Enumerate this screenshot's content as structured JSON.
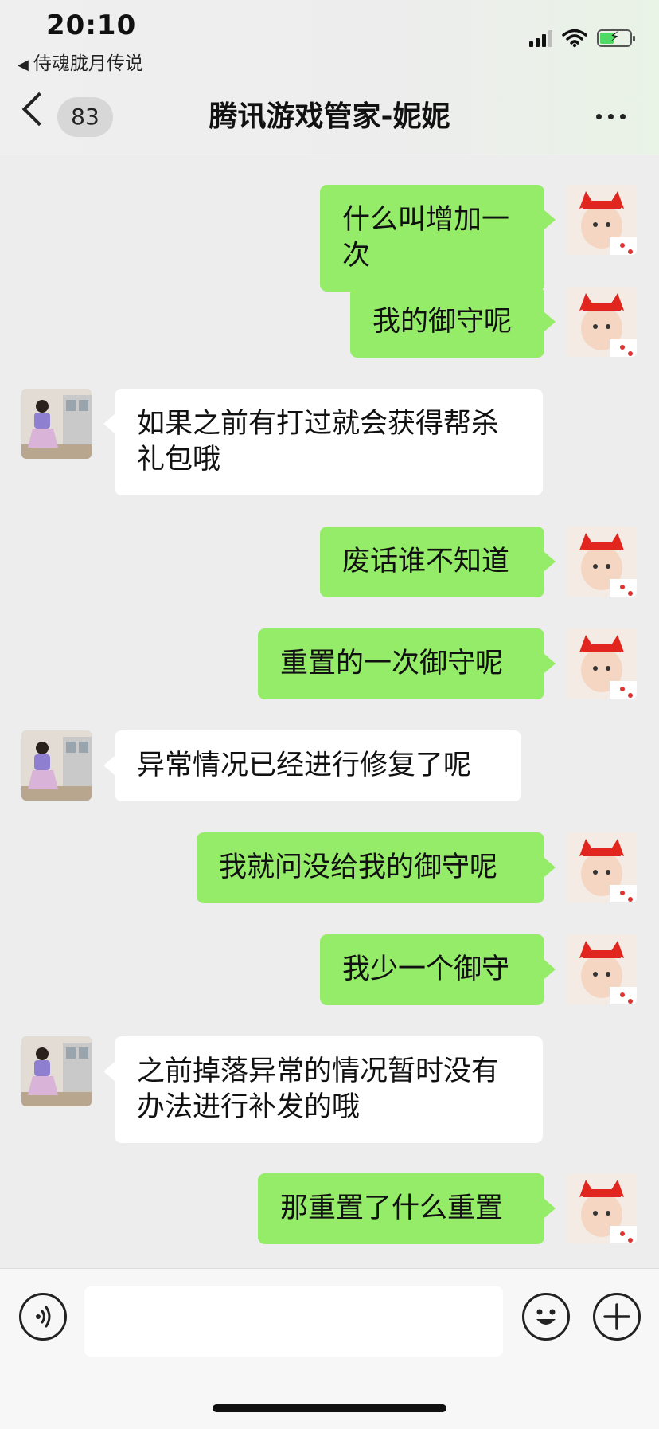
{
  "status_bar": {
    "time": "20:10",
    "back_app_label": "侍魂胧月传说",
    "icons": [
      "cellular-signal-icon",
      "wifi-icon",
      "battery-charging-icon"
    ]
  },
  "header": {
    "unread_count": "83",
    "title": "腾讯游戏管家-妮妮",
    "icons": [
      "back-arrow-icon",
      "more-icon"
    ]
  },
  "messages": [
    {
      "side": "out",
      "text": "什么叫增加一次"
    },
    {
      "side": "out",
      "text": "我的御守呢"
    },
    {
      "side": "in",
      "text": "如果之前有打过就会获得帮杀礼包哦"
    },
    {
      "side": "out",
      "text": "废话谁不知道"
    },
    {
      "side": "out",
      "text": "重置的一次御守呢"
    },
    {
      "side": "in",
      "text": "异常情况已经进行修复了呢"
    },
    {
      "side": "out",
      "text": "我就问没给我的御守呢"
    },
    {
      "side": "out",
      "text": "我少一个御守"
    },
    {
      "side": "in",
      "text": "之前掉落异常的情况暂时没有办法进行补发的哦"
    },
    {
      "side": "out",
      "text": "那重置了什么重置"
    }
  ],
  "input_bar": {
    "text_value": "",
    "icons": [
      "voice-icon",
      "emoji-icon",
      "plus-icon"
    ]
  },
  "colors": {
    "outgoing_bubble": "#95ec69",
    "incoming_bubble": "#ffffff",
    "chat_background": "#ededed"
  }
}
